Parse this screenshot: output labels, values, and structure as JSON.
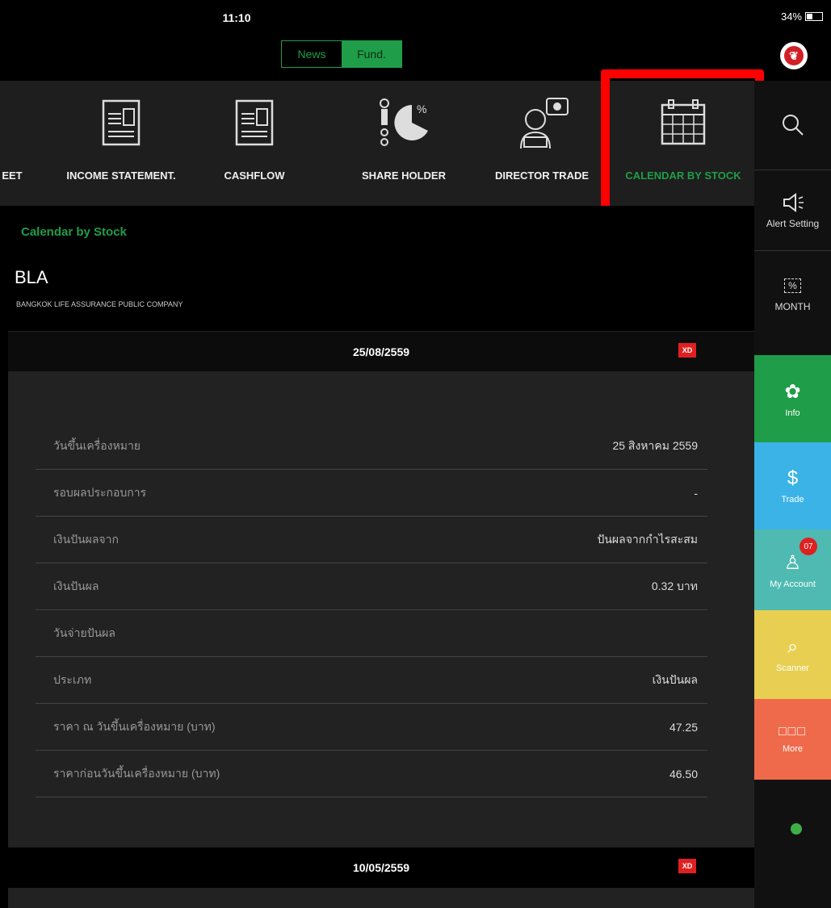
{
  "status": {
    "time": "11:10",
    "battery": "34%"
  },
  "toggle": {
    "news": "News",
    "fund": "Fund."
  },
  "menu": [
    {
      "label": "EET",
      "icon": "doc-icon"
    },
    {
      "label": "INCOME STATEMENT.",
      "icon": "income-statement-icon"
    },
    {
      "label": "CASHFLOW",
      "icon": "cashflow-icon"
    },
    {
      "label": "SHARE HOLDER",
      "icon": "pie-chart-icon"
    },
    {
      "label": "DIRECTOR TRADE",
      "icon": "director-icon"
    },
    {
      "label": "CALENDAR BY STOCK",
      "icon": "calendar-icon",
      "active": true
    }
  ],
  "sidebar": {
    "alert": "Alert Setting",
    "month": "MONTH",
    "info": "Info",
    "trade": "Trade",
    "account": "My Account",
    "account_badge": "07",
    "scanner": "Scanner",
    "more": "More"
  },
  "page": {
    "title": "Calendar by Stock",
    "symbol": "BLA",
    "company": "BANGKOK LIFE ASSURANCE PUBLIC COMPANY"
  },
  "entries": [
    {
      "date": "25/08/2559",
      "tag": "XD",
      "rows": [
        {
          "key": "วันขึ้นเครื่องหมาย",
          "value": "25 สิงหาคม 2559"
        },
        {
          "key": "รอบผลประกอบการ",
          "value": "-"
        },
        {
          "key": "เงินปันผลจาก",
          "value": "ปันผลจากกำไรสะสม"
        },
        {
          "key": "เงินปันผล",
          "value": "0.32 บาท"
        },
        {
          "key": "วันจ่ายปันผล",
          "value": ""
        },
        {
          "key": "ประเภท",
          "value": "เงินปันผล"
        },
        {
          "key": "ราคา ณ วันขึ้นเครื่องหมาย (บาท)",
          "value": "47.25"
        },
        {
          "key": "ราคาก่อนวันขึ้นเครื่องหมาย (บาท)",
          "value": "46.50"
        }
      ]
    },
    {
      "date": "10/05/2559",
      "tag": "XD"
    }
  ],
  "colors": {
    "accent": "#1f9d48",
    "highlight": "#ff0000",
    "xd": "#e02020"
  }
}
